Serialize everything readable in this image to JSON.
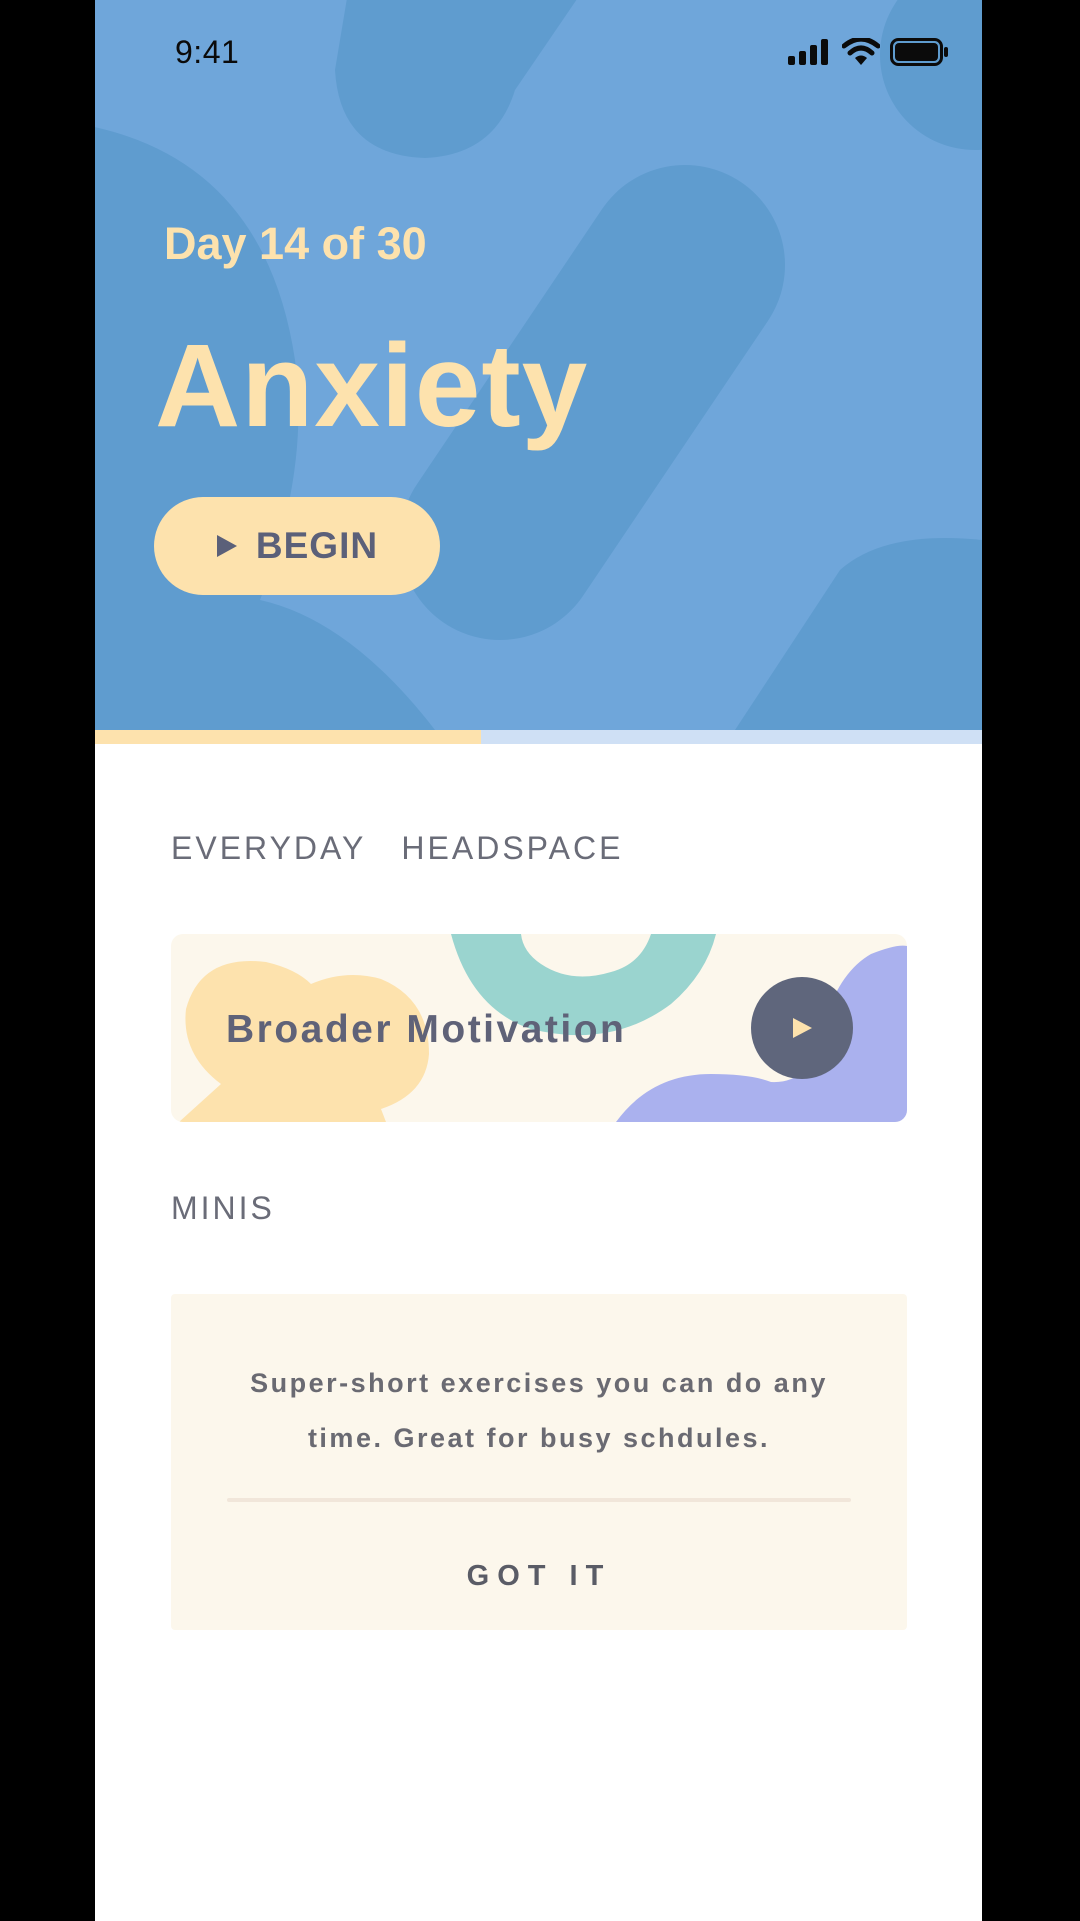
{
  "status_bar": {
    "time": "9:41",
    "icons": [
      "signal-icon",
      "wifi-icon",
      "battery-icon"
    ]
  },
  "hero": {
    "day_label": "Day 14 of 30",
    "title": "Anxiety",
    "begin_button": {
      "icon": "play-icon",
      "label": "BEGIN"
    },
    "progress_fraction": 0.435
  },
  "everyday_section": {
    "title": "EVERYDAY   HEADSPACE",
    "card": {
      "title": "Broader Motivation",
      "action_icon": "play-icon"
    }
  },
  "minis_section": {
    "title": "MINIS",
    "description_line1": "Super-short exercises you can do any",
    "description_line2": "time. Great for busy schdules.",
    "button_label": "GOT IT"
  },
  "colors": {
    "hero_background": "#6fa6da",
    "hero_shapes": "#5f9ccf",
    "accent_yellow": "#fde2ad",
    "card_background": "#fcf7ec",
    "teal": "#9ad4cf",
    "lavender": "#aab1ee",
    "play_button": "#5f667c",
    "text_dark": "#5b6079",
    "text_muted": "#6a6c78"
  }
}
